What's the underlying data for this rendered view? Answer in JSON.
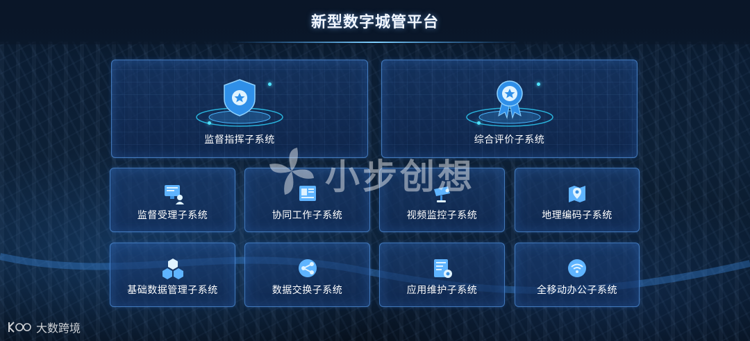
{
  "app": {
    "title": "新型数字城管平台"
  },
  "main_cards": [
    {
      "label": "监督指挥子系统",
      "icon": "shield-star-icon"
    },
    {
      "label": "综合评价子系统",
      "icon": "medal-star-icon"
    }
  ],
  "sub_cards_row1": [
    {
      "label": "监督受理子系统",
      "icon": "computer-user-icon"
    },
    {
      "label": "协同工作子系统",
      "icon": "document-folder-icon"
    },
    {
      "label": "视频监控子系统",
      "icon": "cctv-camera-icon"
    },
    {
      "label": "地理编码子系统",
      "icon": "map-pin-icon"
    }
  ],
  "sub_cards_row2": [
    {
      "label": "基础数据管理子系统",
      "icon": "cubes-icon"
    },
    {
      "label": "数据交换子系统",
      "icon": "share-nodes-icon"
    },
    {
      "label": "应用维护子系统",
      "icon": "document-settings-icon"
    },
    {
      "label": "全移动办公子系统",
      "icon": "wifi-signal-icon"
    }
  ],
  "watermark": {
    "text": "小步创想"
  },
  "footer": {
    "brand": "大数跨境"
  },
  "colors": {
    "accent": "#4fe3ff",
    "card_border": "#5aa0f0",
    "icon_blue": "#5fb4ff"
  }
}
